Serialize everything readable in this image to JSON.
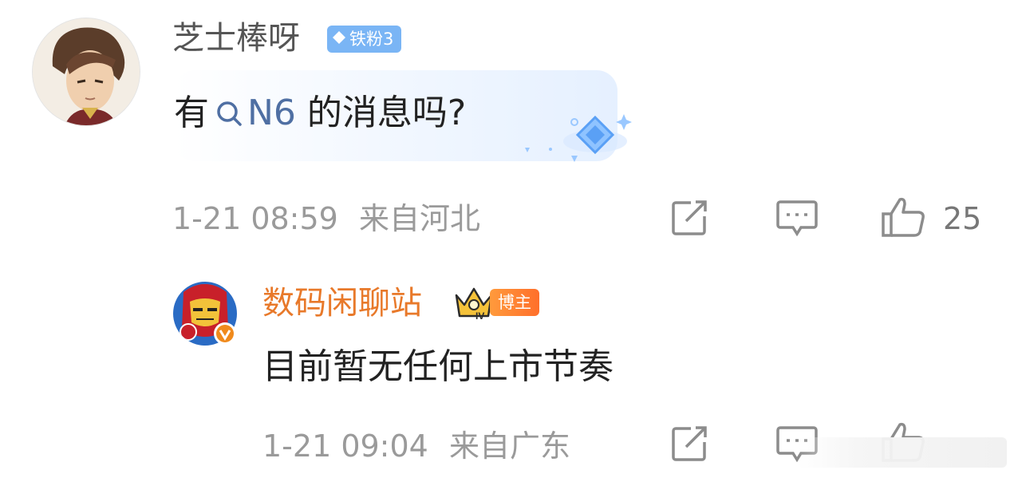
{
  "comment": {
    "author": "芝士棒呀",
    "fan_badge": "铁粉3",
    "text_before": "有",
    "topic": "N6",
    "text_after": "的消息吗?",
    "time": "1-21 08:59",
    "location": "来自河北",
    "like_count": "25",
    "icons": [
      "diamond-icon",
      "search-icon",
      "share-icon",
      "comment-icon",
      "like-icon"
    ]
  },
  "reply": {
    "author": "数码闲聊站",
    "role_badge": "博主",
    "crown_level": "IV",
    "text": "目前暂无任何上市节奏",
    "time": "1-21 09:04",
    "location": "来自广东",
    "like_count": "",
    "icons": [
      "crown-icon",
      "verified-icon",
      "share-icon",
      "comment-icon",
      "like-icon"
    ]
  },
  "colors": {
    "reply_author": "#e8792a",
    "topic_link": "#4f6fa3",
    "meta_text": "#9a9a9a",
    "fan_badge": "#7ab5f5"
  }
}
